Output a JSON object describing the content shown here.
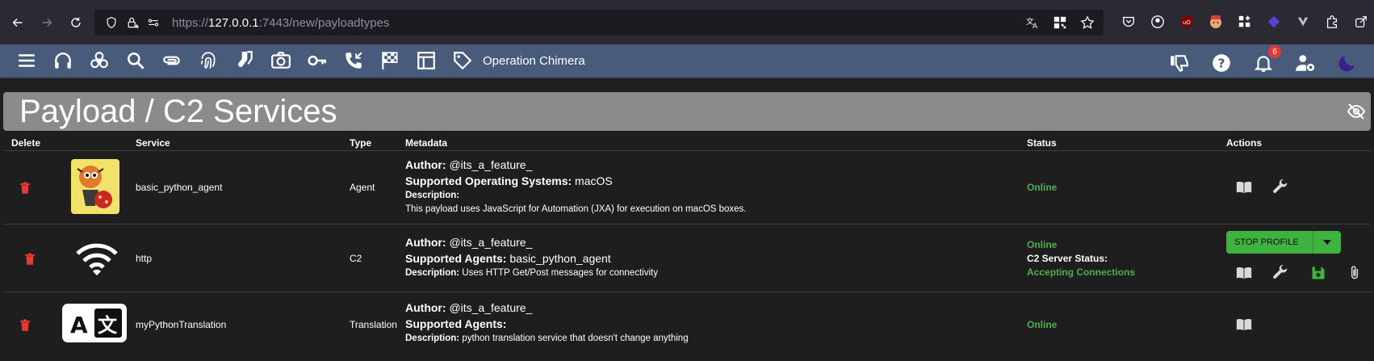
{
  "browser": {
    "url_prefix": "https://",
    "url_host": "127.0.0.1",
    "url_rest": ":7443/new/payloadtypes"
  },
  "appbar": {
    "operation_name": "Operation Chimera",
    "notification_count": "6",
    "icons": [
      "menu-icon",
      "headphones-icon",
      "biohazard-icon",
      "search-icon",
      "paperclip-icon",
      "fingerprint-icon",
      "socks-icon",
      "camera-icon",
      "key-icon",
      "phone-callback-icon",
      "checkered-flag-icon",
      "table-icon",
      "tag-icon"
    ]
  },
  "page": {
    "title": "Payload / C2 Services"
  },
  "table": {
    "headers": {
      "delete": "Delete",
      "service": "Service",
      "type": "Type",
      "metadata": "Metadata",
      "status": "Status",
      "actions": "Actions"
    },
    "rows": [
      {
        "service": "basic_python_agent",
        "type": "Agent",
        "author_label": "Author:",
        "author": "@its_a_feature_",
        "line2_label": "Supported Operating Systems:",
        "line2_value": "macOS",
        "description_label": "Description:",
        "description": "This payload uses JavaScript for Automation (JXA) for execution on macOS boxes.",
        "status": "Online"
      },
      {
        "service": "http",
        "type": "C2",
        "author_label": "Author:",
        "author": "@its_a_feature_",
        "line2_label": "Supported Agents:",
        "line2_value": "basic_python_agent",
        "description_label": "Description:",
        "description": "Uses HTTP Get/Post messages for connectivity",
        "status": "Online",
        "server_status_label": "C2 Server Status:",
        "server_status": "Accepting Connections",
        "stop_label": "STOP PROFILE"
      },
      {
        "service": "myPythonTranslation",
        "type": "Translation",
        "author_label": "Author:",
        "author": "@its_a_feature_",
        "line2_label": "Supported Agents:",
        "line2_value": "",
        "description_label": "Description:",
        "description": "python translation service that doesn't change anything",
        "status": "Online"
      }
    ]
  },
  "colors": {
    "appbar": "#495b7a",
    "title_bar": "#8d8a8a",
    "online": "#4caf50",
    "delete": "#e53935",
    "stop_button": "#3fb33f"
  }
}
